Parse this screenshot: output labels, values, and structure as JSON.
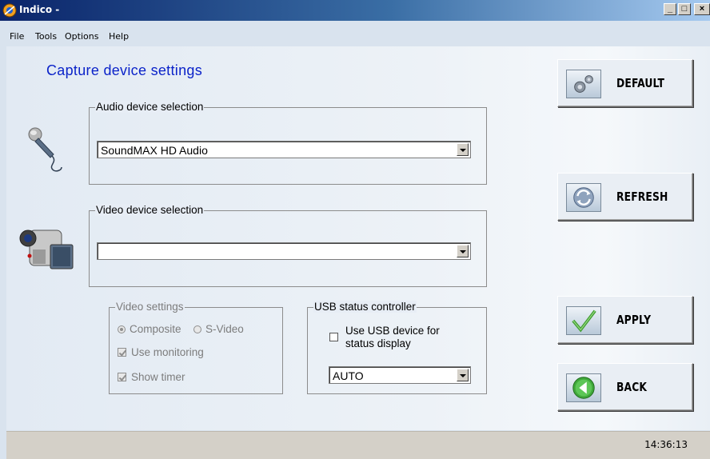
{
  "window": {
    "title": "Indico -",
    "controls": [
      "_",
      "□",
      "×"
    ]
  },
  "menu": [
    "File",
    "Tools",
    "Options",
    "Help"
  ],
  "heading": "Capture device settings",
  "audio": {
    "legend": "Audio device selection",
    "selected": "SoundMAX HD Audio"
  },
  "video": {
    "legend": "Video device selection",
    "selected": ""
  },
  "video_settings": {
    "legend": "Video settings",
    "composite": "Composite",
    "svideo": "S-Video",
    "use_monitoring": "Use monitoring",
    "show_timer": "Show timer",
    "composite_selected": true,
    "use_monitoring_checked": true,
    "show_timer_checked": true
  },
  "usb": {
    "legend": "USB status controller",
    "checkbox_line1": "Use USB device for",
    "checkbox_line2": "status display",
    "checked": false,
    "mode": "AUTO"
  },
  "buttons": {
    "default": "DEFAULT",
    "refresh": "REFRESH",
    "apply": "APPLY",
    "back": "BACK"
  },
  "icons": {
    "app": "indico-app-icon",
    "audio": "microphone-icon",
    "video": "camcorder-icon",
    "default": "gears-icon",
    "refresh": "refresh-arrows-icon",
    "apply": "checkmark-icon",
    "back": "back-arrow-icon"
  },
  "status": {
    "clock": "14:36:13"
  },
  "colors": {
    "heading": "#0b23c9",
    "titlebar": "#0a246a",
    "content": "#e2eaf3",
    "statusbar": "#d4d0c8"
  }
}
